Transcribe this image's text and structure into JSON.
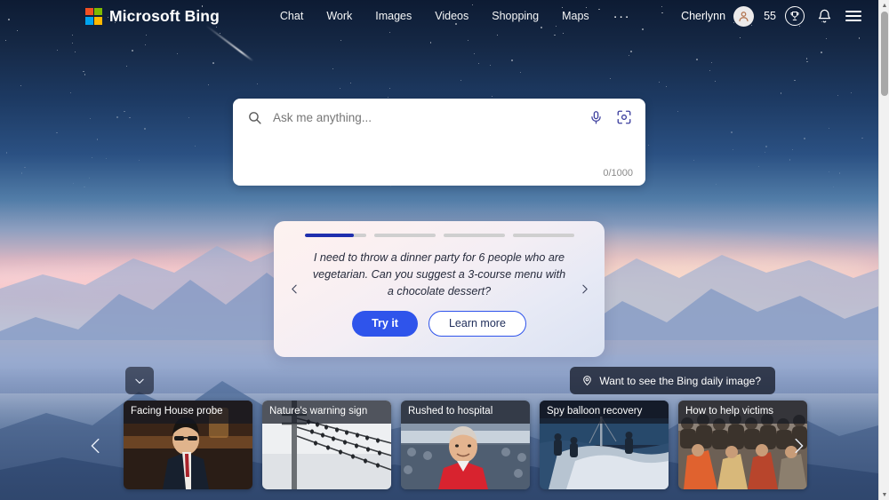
{
  "brand": {
    "name": "Microsoft Bing",
    "logo_icon": "microsoft-squares-icon",
    "logo_colors": [
      "#f25022",
      "#7fba00",
      "#00a4ef",
      "#ffb900"
    ]
  },
  "nav": {
    "links": [
      {
        "label": "Chat"
      },
      {
        "label": "Work"
      },
      {
        "label": "Images"
      },
      {
        "label": "Videos"
      },
      {
        "label": "Shopping"
      },
      {
        "label": "Maps"
      }
    ],
    "more_label": "···",
    "more_icon": "ellipsis-icon"
  },
  "account": {
    "user_name": "Cherlynn",
    "avatar_icon": "person-avatar-icon",
    "rewards_count": "55",
    "rewards_icon": "trophy-icon",
    "notifications_icon": "bell-icon",
    "menu_icon": "hamburger-menu-icon"
  },
  "search": {
    "placeholder": "Ask me anything...",
    "value": "",
    "search_icon": "search-icon",
    "mic_icon": "microphone-icon",
    "visual_icon": "visual-search-camera-icon",
    "char_count": "0/1000"
  },
  "suggestion_card": {
    "progress": {
      "total": 4,
      "active_index": 0,
      "active_fill_percent": 80,
      "active_color": "#1f2fae",
      "inactive_color": "#cfcfcf"
    },
    "prompt": "I need to throw a dinner party for 6 people who are vegetarian. Can you suggest a 3-course menu with a chocolate dessert?",
    "try_label": "Try it",
    "learn_label": "Learn more",
    "prev_icon": "chevron-left-icon",
    "next_icon": "chevron-right-icon",
    "primary_color": "#2f54eb"
  },
  "daily_image": {
    "label": "Want to see the Bing daily image?",
    "pin_icon": "location-pin-icon"
  },
  "collapse": {
    "icon": "chevron-down-icon"
  },
  "news": {
    "prev_icon": "chevron-left-icon",
    "next_icon": "chevron-right-icon",
    "cards": [
      {
        "title": "Facing House probe",
        "image": "politician-at-hearing-photo"
      },
      {
        "title": "Nature's warning sign",
        "image": "birds-on-power-lines-photo"
      },
      {
        "title": "Rushed to hospital",
        "image": "man-in-red-shirt-at-stadium-photo"
      },
      {
        "title": "Spy balloon recovery",
        "image": "navy-crew-recovering-debris-photo"
      },
      {
        "title": "How to help victims",
        "image": "crowd-receiving-aid-photo"
      }
    ]
  },
  "scrollbar": {
    "up_icon": "triangle-up-icon",
    "down_icon": "triangle-down-icon",
    "thumb_position": "top"
  },
  "background": {
    "scene": "twilight-mountain-landscape",
    "sky_top": "#0d1b33",
    "sunset_glow": "#f7d3cd",
    "mountains": "#7c9bc6"
  }
}
